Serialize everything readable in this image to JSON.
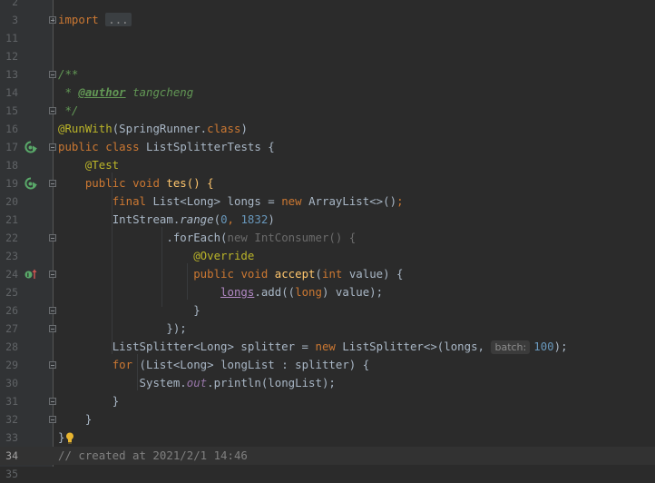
{
  "editor": {
    "lines": [
      {
        "n": "3"
      },
      {
        "n": "11"
      },
      {
        "n": "12"
      },
      {
        "n": "13"
      },
      {
        "n": "14"
      },
      {
        "n": "15"
      },
      {
        "n": "16"
      },
      {
        "n": "17"
      },
      {
        "n": "18"
      },
      {
        "n": "19"
      },
      {
        "n": "20"
      },
      {
        "n": "21"
      },
      {
        "n": "22"
      },
      {
        "n": "23"
      },
      {
        "n": "24"
      },
      {
        "n": "25"
      },
      {
        "n": "26"
      },
      {
        "n": "27"
      },
      {
        "n": "28"
      },
      {
        "n": "29"
      },
      {
        "n": "30"
      },
      {
        "n": "31"
      },
      {
        "n": "32"
      },
      {
        "n": "33"
      },
      {
        "n": "34"
      }
    ],
    "top_partial_line": "2",
    "bottom_partial_line": "35",
    "tokens": {
      "import_kw": "import",
      "import_folded": "...",
      "doc_open": "/**",
      "doc_star": " * ",
      "author_tag": "@author",
      "author_name": " tangcheng",
      "doc_close": " */",
      "runwith_ann": "@RunWith",
      "runwith_arg_a": "(SpringRunner.",
      "runwith_class_kw": "class",
      "runwith_arg_b": ")",
      "public_kw": "public",
      "class_kw": "class",
      "class_name": "ListSplitterTests {",
      "test_ann": "@Test",
      "void_kw": "void",
      "tes_method": "tes() {",
      "final_kw": "final",
      "list_decl": "List<Long> longs = ",
      "new_kw": "new",
      "arraylist": "ArrayList<>()",
      "semicolon": ";",
      "intstream": "IntStream.",
      "range_fn": "range",
      "range_open": "(",
      "range_start": "0",
      "comma_space": ", ",
      "range_end": "1832",
      "range_close": ")",
      "foreach": ".forEach(",
      "intconsumer": "IntConsumer() {",
      "override_ann": "@Override",
      "accept_fn": "accept",
      "accept_open": "(",
      "int_kw": "int",
      "accept_param": "value) {",
      "longs_ref": "longs",
      "add_call": ".add((",
      "long_kw": "long",
      "add_tail": ") value);",
      "close_brace": "}",
      "close_lambda": "});",
      "splitter_decl": "ListSplitter<Long> splitter = ",
      "splitter_ctor": "ListSplitter<>(longs, ",
      "param_hint": "batch:",
      "batch_value": "100",
      "ctor_close": ");",
      "for_kw": "for",
      "for_body": "(List<Long> longList : splitter) {",
      "system": "System.",
      "out_field": "out",
      "println": ".println(longList);",
      "class_close": "}",
      "comment": "// created at 2021/2/1 14:46"
    }
  }
}
